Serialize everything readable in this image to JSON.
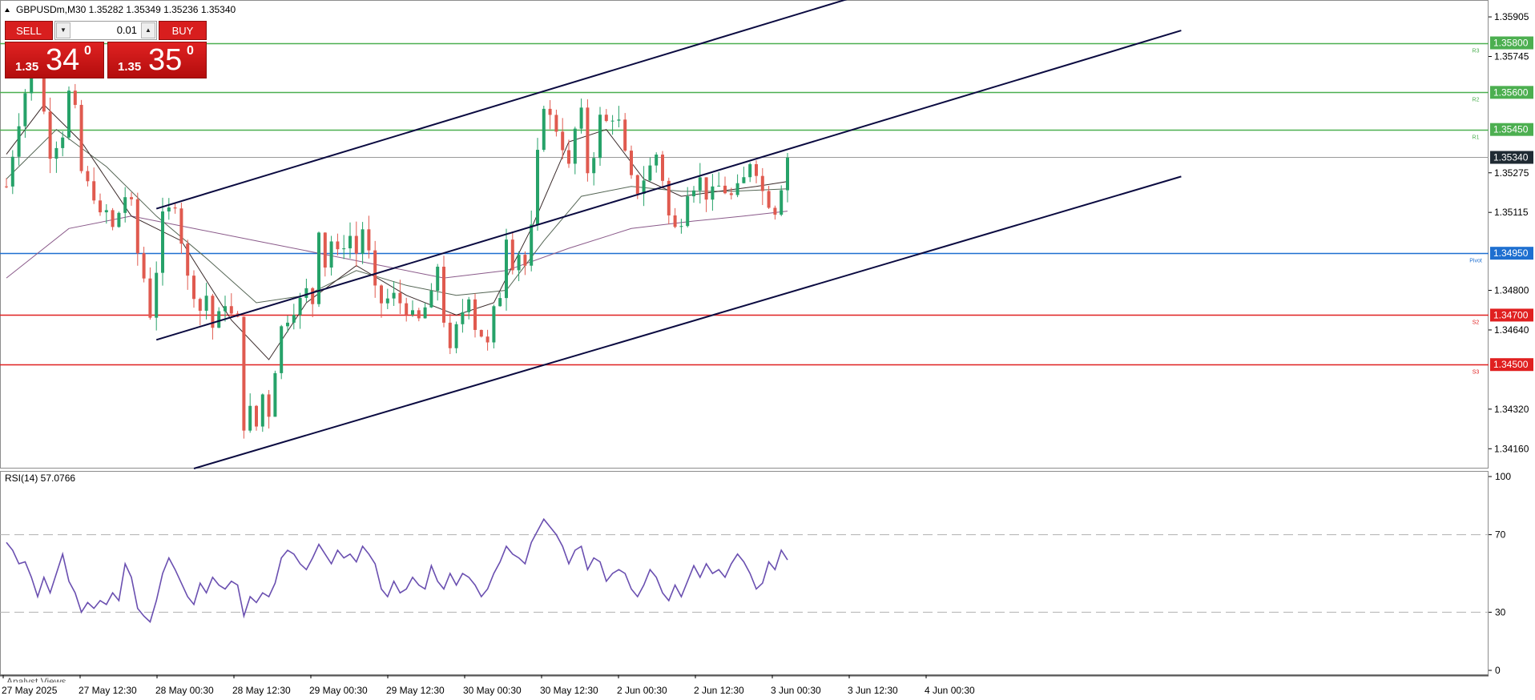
{
  "header": {
    "symbol_info": "GBPUSDm,M30  1.35282 1.35349 1.35236 1.35340"
  },
  "trade_panel": {
    "sell_label": "SELL",
    "buy_label": "BUY",
    "lot_size": "0.01",
    "sell_price_small": "1.35",
    "sell_price_big": "34",
    "sell_price_sup": "0",
    "buy_price_small": "1.35",
    "buy_price_big": "35",
    "buy_price_sup": "0"
  },
  "chart_data": [
    {
      "type": "candlestick",
      "title": "GBPUSDm,M30  1.35282 1.35349 1.35236 1.35340",
      "ylim": [
        1.3408,
        1.3597
      ],
      "y_ticks": [
        1.35905,
        1.35745,
        1.35275,
        1.35115,
        1.348,
        1.3464,
        1.3432,
        1.3416
      ],
      "x_ticks": [
        "27 May 2025",
        "27 May 12:30",
        "28 May 00:30",
        "28 May 12:30",
        "29 May 00:30",
        "29 May 12:30",
        "30 May 00:30",
        "30 May 12:30",
        "2 Jun 00:30",
        "2 Jun 12:30",
        "3 Jun 00:30",
        "3 Jun 12:30",
        "4 Jun 00:30"
      ],
      "current_price": 1.3534,
      "levels": [
        {
          "name": "R3",
          "value": 1.358,
          "color": "#4caf50"
        },
        {
          "name": "R2",
          "value": 1.356,
          "color": "#4caf50"
        },
        {
          "name": "R1",
          "value": 1.3545,
          "color": "#4caf50"
        },
        {
          "name": "Pivot",
          "value": 1.3495,
          "color": "#1e6fd0"
        },
        {
          "name": "S2",
          "value": 1.347,
          "color": "#e02020"
        },
        {
          "name": "S3",
          "value": 1.345,
          "color": "#e02020"
        }
      ],
      "level_labels": [
        "1.35800",
        "1.35600",
        "1.35450",
        "1.34950",
        "1.34700",
        "1.34500"
      ],
      "current_label": "1.35340",
      "colors": {
        "bull": "#26a269",
        "bear": "#e05a4f",
        "channel": "#0a0a40"
      },
      "close_path": [
        [
          0,
          1.3522
        ],
        [
          2,
          1.3548
        ],
        [
          4,
          1.3572
        ],
        [
          5,
          1.3568
        ],
        [
          6,
          1.3552
        ],
        [
          7,
          1.3535
        ],
        [
          9,
          1.3543
        ],
        [
          10,
          1.356
        ],
        [
          11,
          1.3553
        ],
        [
          12,
          1.3528
        ],
        [
          14,
          1.3518
        ],
        [
          15,
          1.351
        ],
        [
          16,
          1.3512
        ],
        [
          17,
          1.3505
        ],
        [
          19,
          1.3518
        ],
        [
          20,
          1.3515
        ],
        [
          21,
          1.3495
        ],
        [
          22,
          1.3485
        ],
        [
          23,
          1.347
        ],
        [
          24,
          1.3488
        ],
        [
          25,
          1.351
        ],
        [
          27,
          1.3515
        ],
        [
          28,
          1.35
        ],
        [
          29,
          1.3485
        ],
        [
          31,
          1.3472
        ],
        [
          32,
          1.3478
        ],
        [
          33,
          1.3465
        ],
        [
          35,
          1.3475
        ],
        [
          36,
          1.347
        ],
        [
          37,
          1.3468
        ],
        [
          38,
          1.3425
        ],
        [
          39,
          1.3432
        ],
        [
          40,
          1.3425
        ],
        [
          41,
          1.3438
        ],
        [
          42,
          1.343
        ],
        [
          43,
          1.3448
        ],
        [
          44,
          1.3465
        ],
        [
          46,
          1.3472
        ],
        [
          48,
          1.348
        ],
        [
          49,
          1.3475
        ],
        [
          50,
          1.3505
        ],
        [
          51,
          1.349
        ],
        [
          52,
          1.35
        ],
        [
          53,
          1.3495
        ],
        [
          55,
          1.3502
        ],
        [
          56,
          1.3495
        ],
        [
          57,
          1.3505
        ],
        [
          58,
          1.3495
        ],
        [
          59,
          1.348
        ],
        [
          60,
          1.3475
        ],
        [
          62,
          1.3478
        ],
        [
          64,
          1.3472
        ],
        [
          66,
          1.3468
        ],
        [
          68,
          1.3478
        ],
        [
          69,
          1.349
        ],
        [
          70,
          1.3468
        ],
        [
          71,
          1.3455
        ],
        [
          72,
          1.3465
        ],
        [
          74,
          1.3478
        ],
        [
          75,
          1.3465
        ],
        [
          76,
          1.3462
        ],
        [
          77,
          1.3458
        ],
        [
          78,
          1.3472
        ],
        [
          79,
          1.3478
        ],
        [
          80,
          1.3502
        ],
        [
          81,
          1.349
        ],
        [
          82,
          1.3495
        ],
        [
          83,
          1.349
        ],
        [
          84,
          1.3505
        ],
        [
          85,
          1.3535
        ],
        [
          86,
          1.3555
        ],
        [
          87,
          1.355
        ],
        [
          88,
          1.3545
        ],
        [
          89,
          1.3538
        ],
        [
          90,
          1.353
        ],
        [
          91,
          1.3545
        ],
        [
          92,
          1.3552
        ],
        [
          93,
          1.3528
        ],
        [
          94,
          1.3535
        ],
        [
          95,
          1.355
        ],
        [
          96,
          1.3548
        ],
        [
          97,
          1.355
        ],
        [
          98,
          1.3548
        ],
        [
          99,
          1.3535
        ],
        [
          100,
          1.3525
        ],
        [
          101,
          1.352
        ],
        [
          102,
          1.3525
        ],
        [
          104,
          1.3535
        ],
        [
          105,
          1.3525
        ],
        [
          106,
          1.351
        ],
        [
          107,
          1.3505
        ],
        [
          108,
          1.3508
        ],
        [
          109,
          1.352
        ],
        [
          110,
          1.3522
        ],
        [
          111,
          1.3525
        ],
        [
          112,
          1.3518
        ],
        [
          114,
          1.3522
        ],
        [
          116,
          1.3518
        ],
        [
          118,
          1.3525
        ],
        [
          119,
          1.3532
        ],
        [
          120,
          1.3528
        ],
        [
          121,
          1.352
        ],
        [
          122,
          1.3515
        ],
        [
          123,
          1.3512
        ],
        [
          124,
          1.3522
        ],
        [
          125,
          1.3534
        ]
      ],
      "sma_fast": [
        [
          0,
          1.3535
        ],
        [
          6,
          1.3555
        ],
        [
          12,
          1.354
        ],
        [
          20,
          1.351
        ],
        [
          28,
          1.35
        ],
        [
          36,
          1.3468
        ],
        [
          42,
          1.3452
        ],
        [
          48,
          1.3475
        ],
        [
          56,
          1.349
        ],
        [
          64,
          1.3478
        ],
        [
          72,
          1.347
        ],
        [
          78,
          1.3475
        ],
        [
          84,
          1.3505
        ],
        [
          90,
          1.354
        ],
        [
          96,
          1.3545
        ],
        [
          102,
          1.3525
        ],
        [
          108,
          1.3518
        ],
        [
          114,
          1.352
        ],
        [
          120,
          1.3522
        ],
        [
          125,
          1.3524
        ]
      ],
      "sma_mid": [
        [
          0,
          1.3525
        ],
        [
          8,
          1.3545
        ],
        [
          16,
          1.353
        ],
        [
          24,
          1.351
        ],
        [
          32,
          1.3493
        ],
        [
          40,
          1.3475
        ],
        [
          48,
          1.3478
        ],
        [
          56,
          1.3488
        ],
        [
          64,
          1.3482
        ],
        [
          72,
          1.3478
        ],
        [
          80,
          1.348
        ],
        [
          86,
          1.35
        ],
        [
          92,
          1.3518
        ],
        [
          100,
          1.3522
        ],
        [
          108,
          1.352
        ],
        [
          116,
          1.352
        ],
        [
          125,
          1.3521
        ]
      ],
      "sma_slow": [
        [
          0,
          1.3485
        ],
        [
          10,
          1.3505
        ],
        [
          20,
          1.351
        ],
        [
          30,
          1.3505
        ],
        [
          40,
          1.35
        ],
        [
          50,
          1.3495
        ],
        [
          60,
          1.349
        ],
        [
          70,
          1.3485
        ],
        [
          80,
          1.3488
        ],
        [
          90,
          1.3497
        ],
        [
          100,
          1.3505
        ],
        [
          110,
          1.3508
        ],
        [
          118,
          1.351
        ],
        [
          125,
          1.3512
        ]
      ],
      "channel_lines": [
        {
          "from": [
            24,
            1.3513
          ],
          "to": [
            135,
            1.3598
          ]
        },
        {
          "from": [
            24,
            1.346
          ],
          "to": [
            188,
            1.3585
          ]
        },
        {
          "from": [
            30,
            1.3408
          ],
          "to": [
            188,
            1.3526
          ]
        }
      ]
    },
    {
      "type": "line",
      "title": "RSI(14) 57.0766",
      "ylim": [
        0,
        100
      ],
      "y_ticks": [
        100,
        70,
        30,
        0
      ],
      "levels": [
        70,
        30
      ],
      "series": [
        {
          "name": "RSI(14)",
          "color": "#6a4fb0",
          "values": [
            [
              0,
              66
            ],
            [
              1,
              62
            ],
            [
              2,
              55
            ],
            [
              3,
              56
            ],
            [
              4,
              48
            ],
            [
              5,
              38
            ],
            [
              6,
              48
            ],
            [
              7,
              40
            ],
            [
              8,
              50
            ],
            [
              9,
              60
            ],
            [
              10,
              46
            ],
            [
              11,
              40
            ],
            [
              12,
              30
            ],
            [
              13,
              35
            ],
            [
              14,
              32
            ],
            [
              15,
              36
            ],
            [
              16,
              34
            ],
            [
              17,
              40
            ],
            [
              18,
              36
            ],
            [
              19,
              55
            ],
            [
              20,
              48
            ],
            [
              21,
              32
            ],
            [
              22,
              28
            ],
            [
              23,
              25
            ],
            [
              24,
              36
            ],
            [
              25,
              50
            ],
            [
              26,
              58
            ],
            [
              27,
              52
            ],
            [
              28,
              45
            ],
            [
              29,
              38
            ],
            [
              30,
              34
            ],
            [
              31,
              45
            ],
            [
              32,
              40
            ],
            [
              33,
              48
            ],
            [
              34,
              44
            ],
            [
              35,
              42
            ],
            [
              36,
              46
            ],
            [
              37,
              44
            ],
            [
              38,
              28
            ],
            [
              39,
              38
            ],
            [
              40,
              35
            ],
            [
              41,
              40
            ],
            [
              42,
              38
            ],
            [
              43,
              45
            ],
            [
              44,
              58
            ],
            [
              45,
              62
            ],
            [
              46,
              60
            ],
            [
              47,
              55
            ],
            [
              48,
              52
            ],
            [
              49,
              58
            ],
            [
              50,
              65
            ],
            [
              51,
              60
            ],
            [
              52,
              55
            ],
            [
              53,
              62
            ],
            [
              54,
              58
            ],
            [
              55,
              60
            ],
            [
              56,
              56
            ],
            [
              57,
              64
            ],
            [
              58,
              60
            ],
            [
              59,
              55
            ],
            [
              60,
              42
            ],
            [
              61,
              38
            ],
            [
              62,
              46
            ],
            [
              63,
              40
            ],
            [
              64,
              42
            ],
            [
              65,
              48
            ],
            [
              66,
              44
            ],
            [
              67,
              42
            ],
            [
              68,
              54
            ],
            [
              69,
              46
            ],
            [
              70,
              42
            ],
            [
              71,
              50
            ],
            [
              72,
              44
            ],
            [
              73,
              50
            ],
            [
              74,
              48
            ],
            [
              75,
              44
            ],
            [
              76,
              38
            ],
            [
              77,
              42
            ],
            [
              78,
              50
            ],
            [
              79,
              56
            ],
            [
              80,
              64
            ],
            [
              81,
              60
            ],
            [
              82,
              58
            ],
            [
              83,
              55
            ],
            [
              84,
              66
            ],
            [
              85,
              72
            ],
            [
              86,
              78
            ],
            [
              87,
              74
            ],
            [
              88,
              70
            ],
            [
              89,
              64
            ],
            [
              90,
              55
            ],
            [
              91,
              62
            ],
            [
              92,
              64
            ],
            [
              93,
              52
            ],
            [
              94,
              58
            ],
            [
              95,
              56
            ],
            [
              96,
              46
            ],
            [
              97,
              50
            ],
            [
              98,
              52
            ],
            [
              99,
              50
            ],
            [
              100,
              42
            ],
            [
              101,
              38
            ],
            [
              102,
              44
            ],
            [
              103,
              52
            ],
            [
              104,
              48
            ],
            [
              105,
              40
            ],
            [
              106,
              36
            ],
            [
              107,
              44
            ],
            [
              108,
              38
            ],
            [
              109,
              46
            ],
            [
              110,
              54
            ],
            [
              111,
              48
            ],
            [
              112,
              55
            ],
            [
              113,
              50
            ],
            [
              114,
              52
            ],
            [
              115,
              48
            ],
            [
              116,
              55
            ],
            [
              117,
              60
            ],
            [
              118,
              56
            ],
            [
              119,
              50
            ],
            [
              120,
              42
            ],
            [
              121,
              45
            ],
            [
              122,
              56
            ],
            [
              123,
              52
            ],
            [
              124,
              62
            ],
            [
              125,
              57
            ]
          ]
        }
      ]
    }
  ],
  "labels": {
    "rsi_title": "RSI(14) 57.0766",
    "analyst_views": "Analyst Views"
  }
}
